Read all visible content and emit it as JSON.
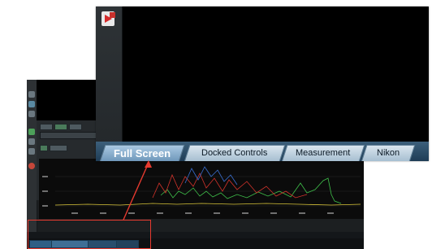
{
  "foreground_window": {
    "tabs": [
      {
        "label": "Full Screen",
        "active": true
      },
      {
        "label": "Docked Controls",
        "active": false
      },
      {
        "label": "Measurement",
        "active": false
      },
      {
        "label": "Nikon",
        "active": false
      }
    ]
  },
  "colors": {
    "callout": "#e63a2f",
    "tab_active": "#7aa3c6",
    "tab_inactive": "#c7d7e4",
    "graph_green": "#3fbf4a",
    "graph_red": "#d2332b",
    "graph_blue": "#3a6fd1",
    "graph_yellow": "#d8c43a"
  },
  "icons": {
    "app_icon": "red-arrow-app-icon",
    "tool_icons": [
      "wrench-icon",
      "zoom-icon",
      "camera-icon",
      "color-icon",
      "record-icon"
    ]
  }
}
